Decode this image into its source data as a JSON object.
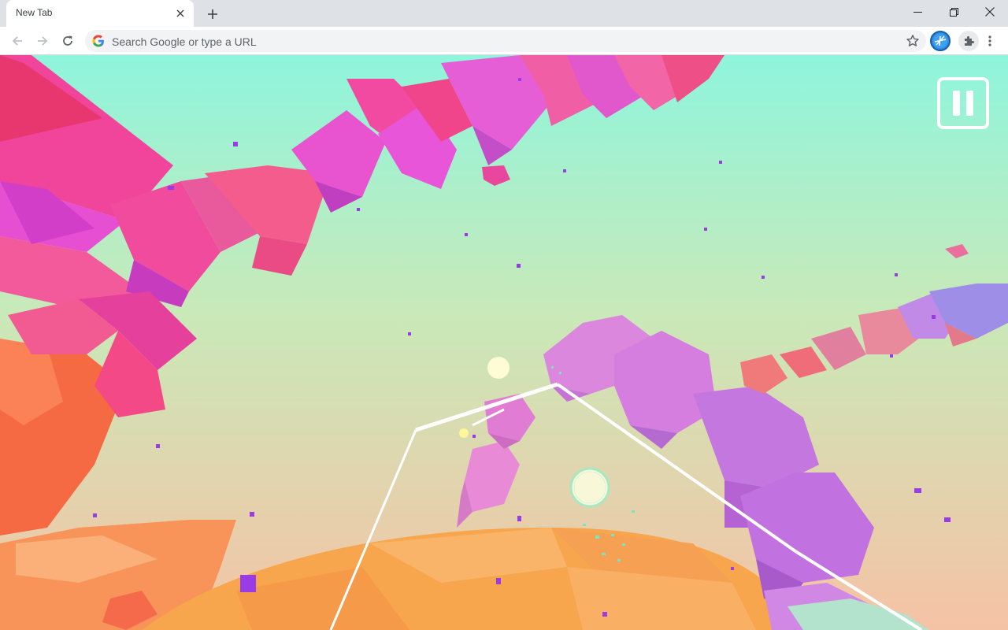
{
  "browser": {
    "tab_title": "New Tab",
    "omnibox_placeholder": "Search Google or type a URL",
    "icons": [
      "close-icon",
      "plus-icon",
      "minimize-icon",
      "restore-icon",
      "back-arrow-icon",
      "forward-arrow-icon",
      "reload-icon",
      "google-g-icon",
      "star-icon",
      "profile-avatar-icon",
      "puzzle-extension-icon",
      "kebab-menu-icon"
    ]
  },
  "game": {
    "pause_icon": "pause-icon",
    "colors": {
      "sky_top": "#8ef5dc",
      "sky_mid": "#c9e9b8",
      "sky_bottom": "#f6c2a5",
      "crystal_pink": "#f0459a",
      "crystal_magenta": "#e34bd3",
      "crystal_violet": "#c27ae0",
      "ground_orange": "#f7a64d",
      "rock_orange": "#f56a43"
    }
  }
}
